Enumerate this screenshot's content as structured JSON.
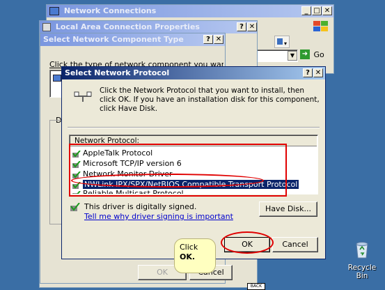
{
  "network_connections": {
    "title": "Network Connections",
    "go_label": "Go",
    "minimize": "_",
    "maximize": "□",
    "close": "✕"
  },
  "lac_props": {
    "title": "Local Area Connection Properties",
    "help": "?",
    "close": "✕"
  },
  "select_component": {
    "title": "Select Network Component Type",
    "instruction": "Click the type of network component you want to install:",
    "desc_label": "De",
    "ok_label": "OK",
    "cancel_label": "Cancel",
    "help": "?",
    "close": "✕"
  },
  "dialog": {
    "title": "Select Network Protocol",
    "help": "?",
    "close": "✕",
    "instruction": "Click the Network Protocol that you want to install, then click OK. If you have an installation disk for this component, click Have Disk.",
    "list_header": "Network Protocol:",
    "protocols": [
      "AppleTalk Protocol",
      "Microsoft TCP/IP version 6",
      "Network Monitor Driver",
      "NWLink IPX/SPX/NetBIOS Compatible Transport Protocol",
      "Reliable Multicast Protocol"
    ],
    "signed_text": "This driver is digitally signed.",
    "signing_link": "Tell me why driver signing is important",
    "have_disk_label": "Have Disk...",
    "ok_label": "OK",
    "cancel_label": "Cancel"
  },
  "callout": {
    "line1": "Click",
    "line2": "OK."
  },
  "back_label": "BACK",
  "desktop": {
    "recycle_bin_label": "Recycle Bin"
  },
  "colors": {
    "desktop": "#3a6ea5",
    "highlight": "#0a246a",
    "annotation_red": "#e00000",
    "callout_bg": "#ffffc0"
  }
}
